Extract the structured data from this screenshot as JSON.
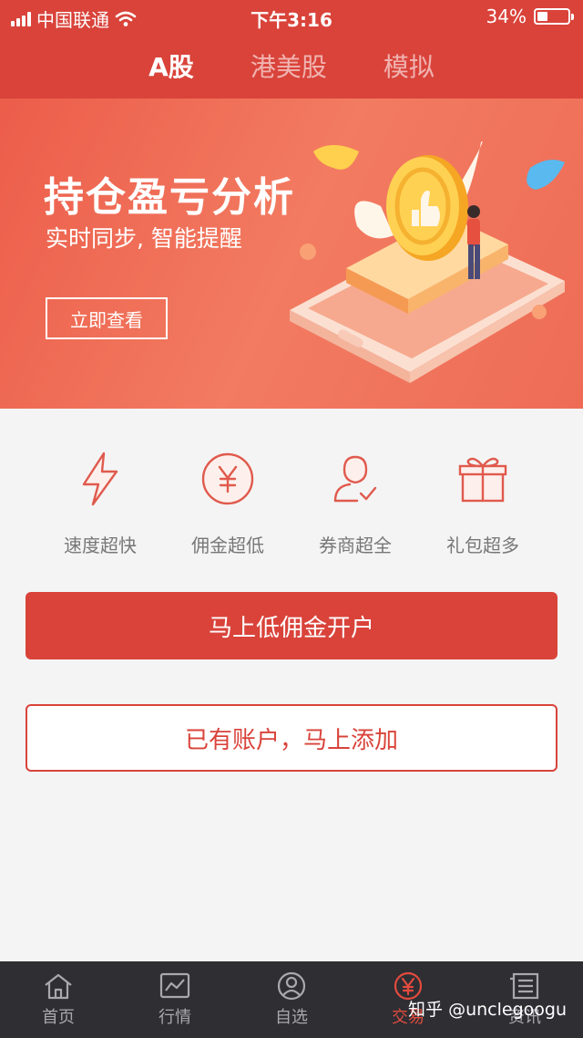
{
  "status_bar": {
    "carrier": "中国联通",
    "time": "下午3:16",
    "battery": "34%"
  },
  "tabs": [
    {
      "label": "A股",
      "active": true
    },
    {
      "label": "港美股",
      "active": false
    },
    {
      "label": "模拟",
      "active": false
    }
  ],
  "banner": {
    "title": "持仓盈亏分析",
    "subtitle": "实时同步, 智能提醒",
    "button": "立即查看"
  },
  "features": [
    {
      "label": "速度超快",
      "icon": "lightning-icon"
    },
    {
      "label": "佣金超低",
      "icon": "yuan-coin-icon"
    },
    {
      "label": "券商超全",
      "icon": "user-check-icon"
    },
    {
      "label": "礼包超多",
      "icon": "gift-icon"
    }
  ],
  "actions": {
    "open_account": "马上低佣金开户",
    "add_account": "已有账户，马上添加"
  },
  "bottom_nav": [
    {
      "label": "首页",
      "icon": "home-icon",
      "active": false
    },
    {
      "label": "行情",
      "icon": "chart-icon",
      "active": false
    },
    {
      "label": "自选",
      "icon": "user-circle-icon",
      "active": false
    },
    {
      "label": "交易",
      "icon": "trade-icon",
      "active": true
    },
    {
      "label": "资讯",
      "icon": "news-icon",
      "active": false
    }
  ],
  "watermark": "知乎 @unclegoogu",
  "colors": {
    "brand": "#d9433a",
    "nav_bg": "#2e2e33",
    "active_nav": "#e24b3e"
  }
}
